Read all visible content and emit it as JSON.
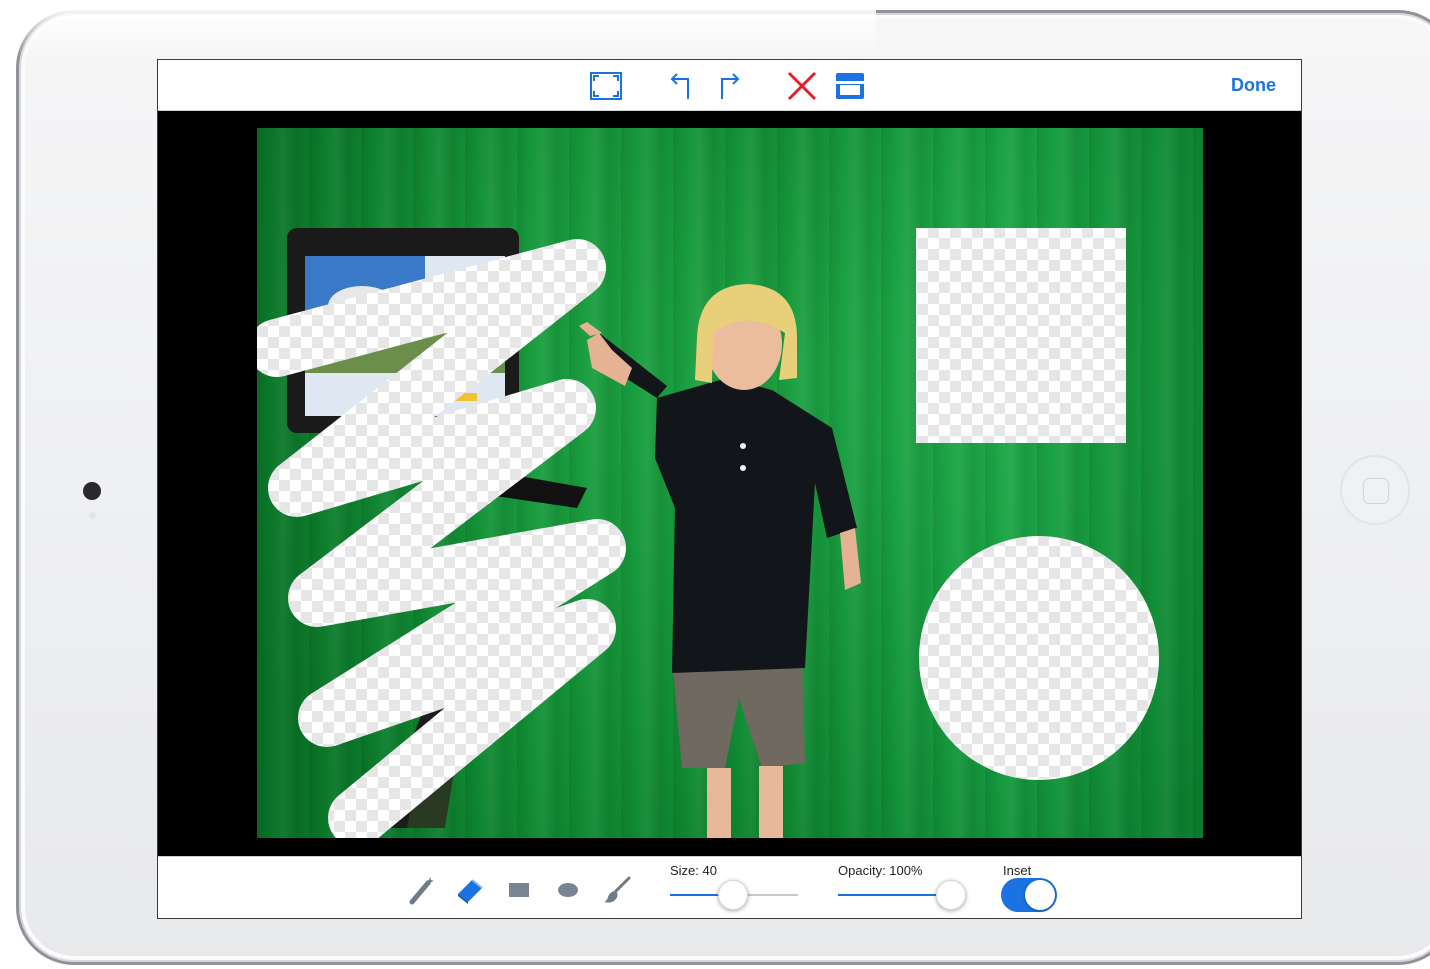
{
  "toolbar": {
    "icons": [
      "crop-icon",
      "undo-icon",
      "redo-icon",
      "clear-icon",
      "save-icon"
    ],
    "done_label": "Done",
    "clear_color": "#e0202a",
    "accent_color": "#1a73e0"
  },
  "canvas": {
    "subject": "child pointing in front of green screen",
    "background_color": "#0f9d3a",
    "erased_shapes": [
      "freehand-scribble",
      "rectangle",
      "ellipse"
    ]
  },
  "tools": {
    "items": [
      "magic-wand-icon",
      "eraser-icon",
      "rectangle-icon",
      "ellipse-icon",
      "brush-icon"
    ],
    "selected": "eraser-icon"
  },
  "size": {
    "label": "Size: 40",
    "value": 40,
    "max": 100
  },
  "opacity": {
    "label": "Opacity: 100%",
    "value": 100,
    "max": 100
  },
  "inset": {
    "label": "Inset",
    "on": true
  }
}
